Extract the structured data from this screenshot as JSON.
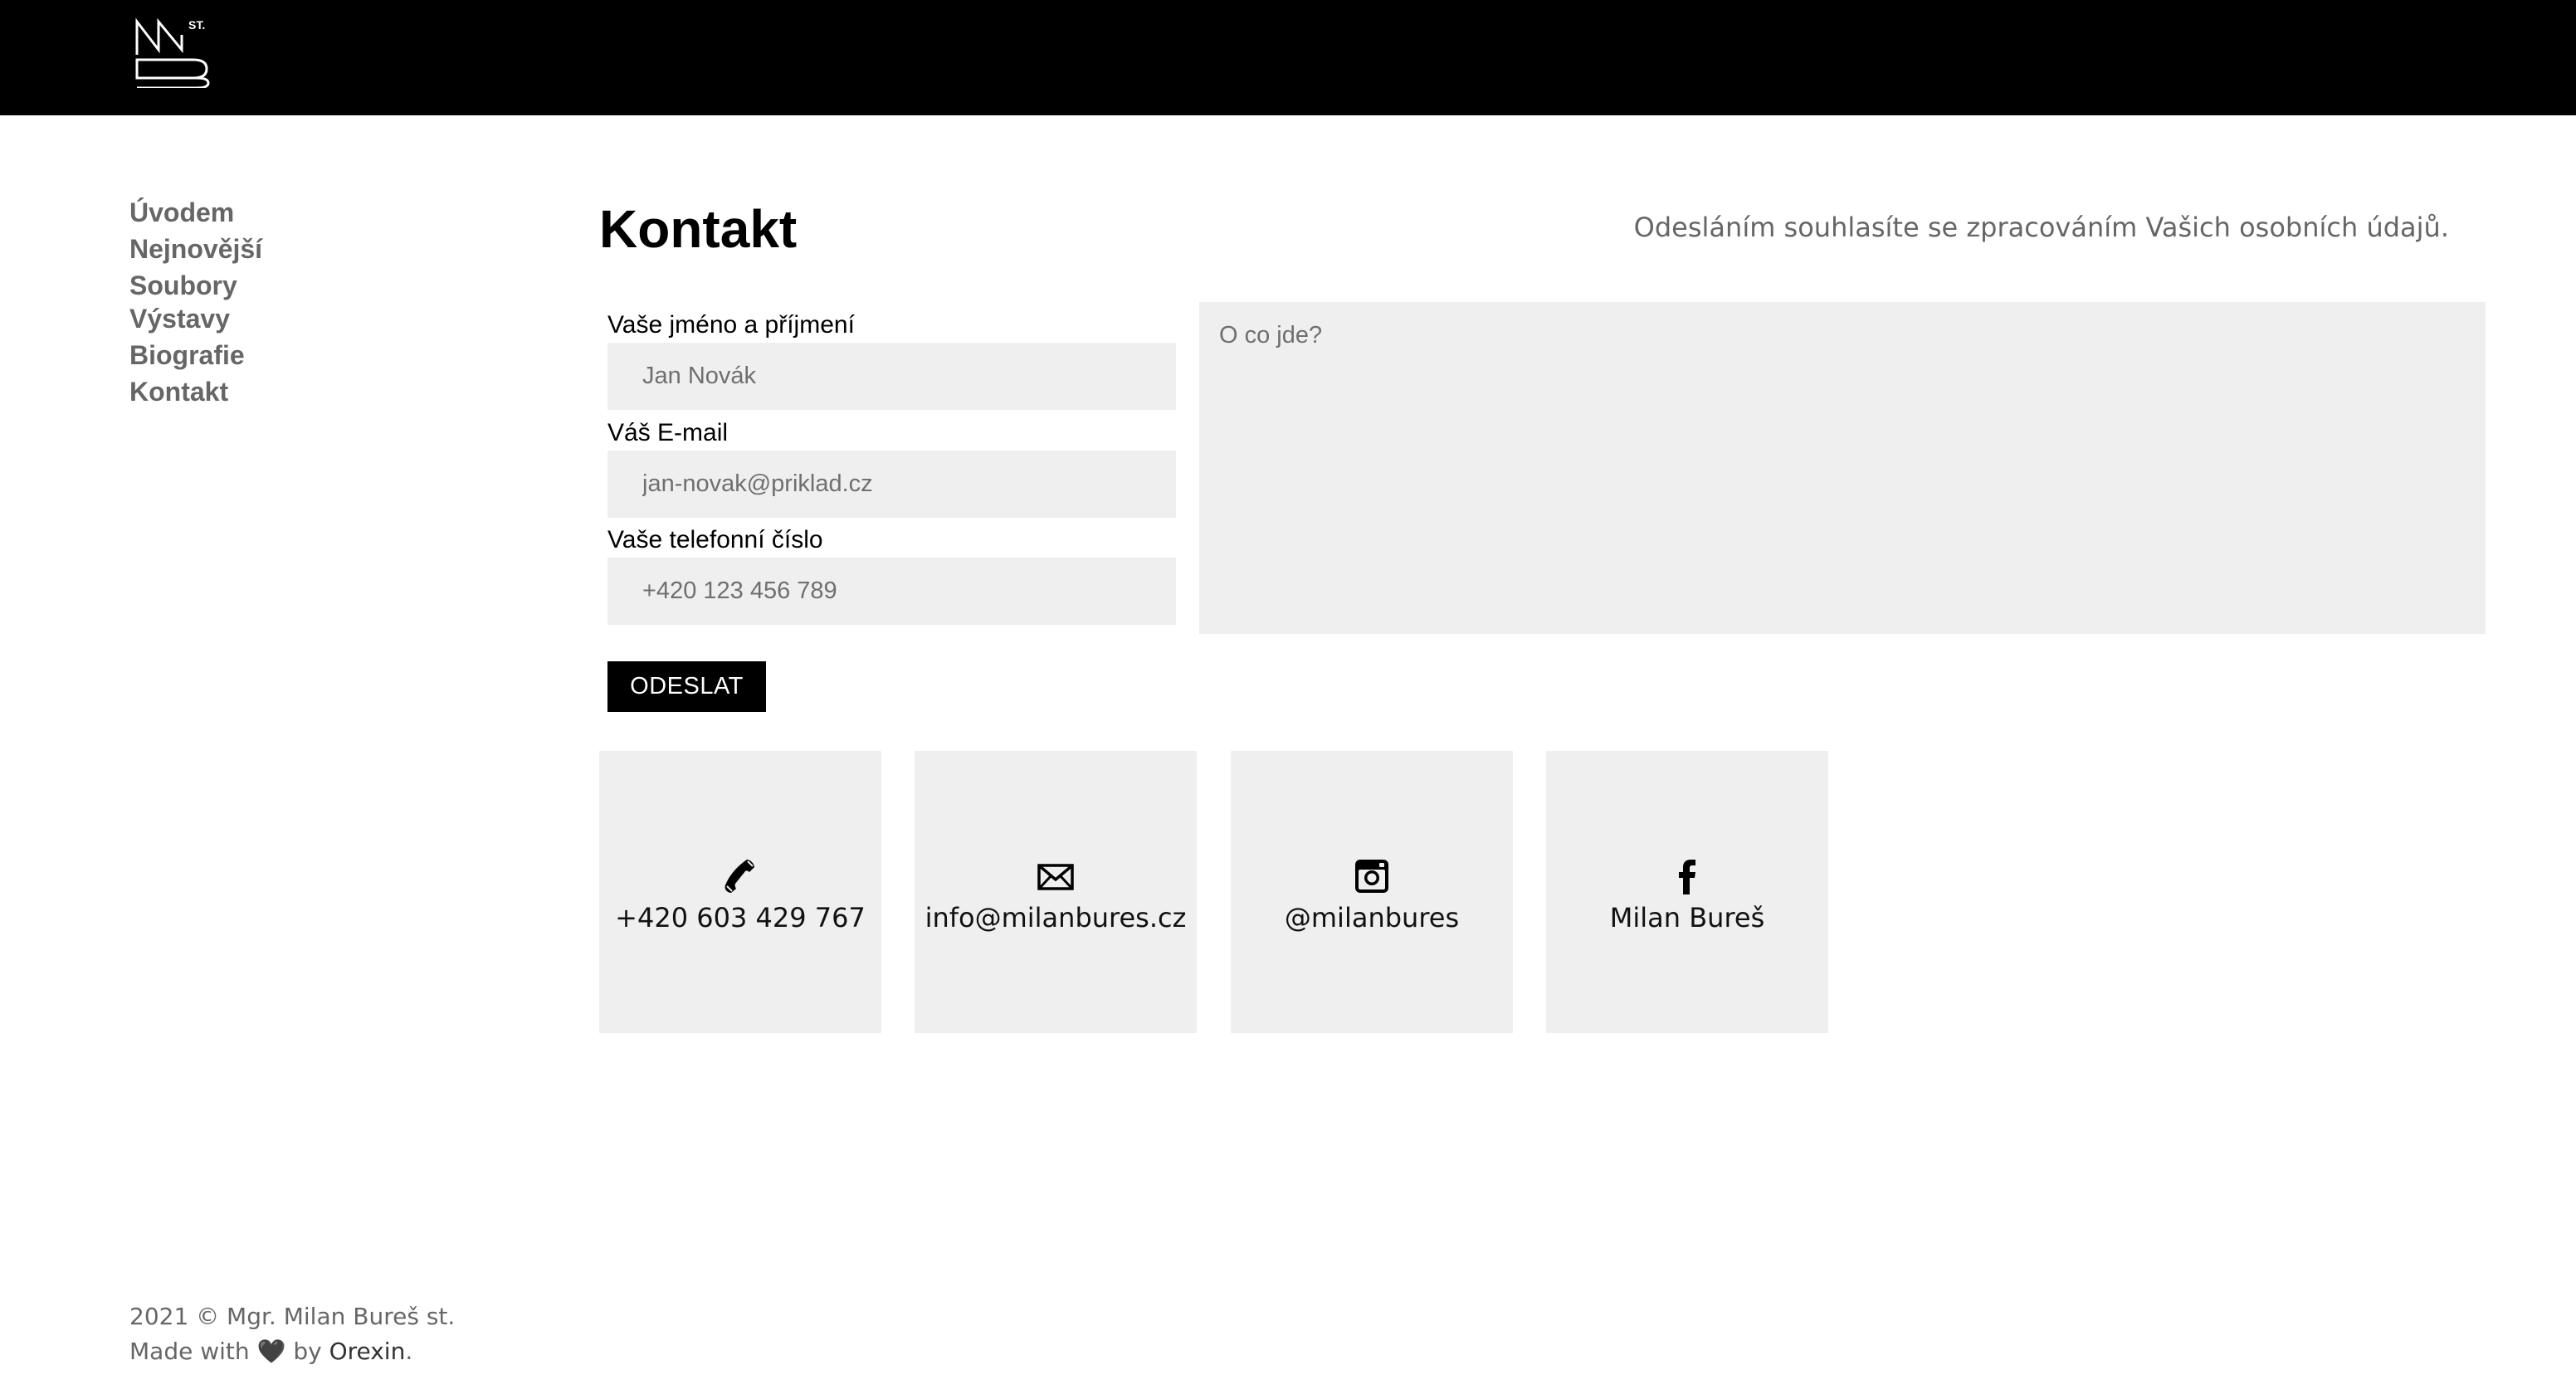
{
  "colors": {
    "topbar": "#000000",
    "nav_text": "#666666",
    "field_bg": "#efefef",
    "button_bg": "#000000",
    "button_text": "#ffffff"
  },
  "header": {
    "logo_text": "MB ST."
  },
  "sidebar": {
    "items": [
      {
        "label": "Úvodem"
      },
      {
        "label": "Nejnovější"
      },
      {
        "label": "Soubory"
      },
      {
        "label": "Výstavy"
      },
      {
        "label": "Biografie"
      },
      {
        "label": "Kontakt"
      }
    ]
  },
  "main": {
    "title": "Kontakt",
    "consent_text": "Odesláním souhlasíte se zpracováním Vašich osobních údajů.",
    "form": {
      "name": {
        "label": "Vaše jméno a příjmení",
        "placeholder": "Jan Novák",
        "value": ""
      },
      "email": {
        "label": "Váš E-mail",
        "placeholder": "jan-novak@priklad.cz",
        "value": ""
      },
      "phone": {
        "label": "Vaše telefonní číslo",
        "placeholder": "+420 123 456 789",
        "value": ""
      },
      "message": {
        "placeholder": "O co jde?",
        "value": ""
      },
      "submit_label": "ODESLAT"
    },
    "cards": [
      {
        "icon": "phone-icon",
        "text": "+420 603 429 767"
      },
      {
        "icon": "mail-icon",
        "text": "info@milanbures.cz"
      },
      {
        "icon": "instagram-icon",
        "text": "@milanbures"
      },
      {
        "icon": "facebook-icon",
        "text": "Milan Bureš"
      }
    ]
  },
  "footer": {
    "copyright": "2021 © Mgr. Milan Bureš st.",
    "made_with": "Made with",
    "heart": "🖤",
    "by": "by",
    "brand": "Orexin",
    "dot": "."
  }
}
